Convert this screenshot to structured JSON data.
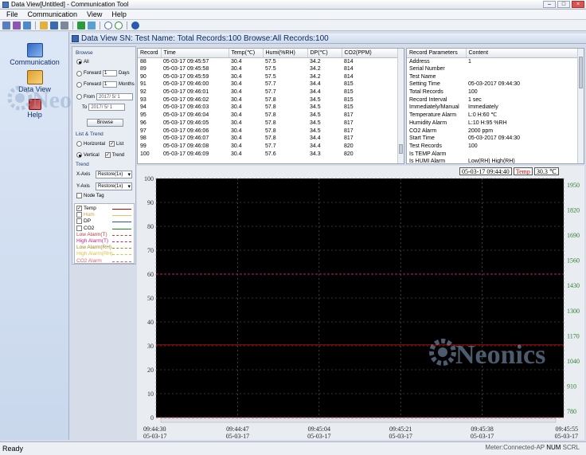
{
  "window": {
    "title": "Data View[Untitled] - Communication Tool"
  },
  "menu": [
    "File",
    "Communication",
    "View",
    "Help"
  ],
  "nav": {
    "communication": "Communication",
    "data_view": "Data View",
    "help": "Help"
  },
  "watermark": "Neonics",
  "header": {
    "text": "Data View  SN: Test Name:  Total Records:100 Browse:All Records:100"
  },
  "browse": {
    "group_label": "Browse",
    "all_label": "All",
    "forward_label": "Forward",
    "forward_days_value": "1",
    "days_label": "Days",
    "forward_months_value": "1",
    "months_label": "Months",
    "from_label": "From",
    "from_value": "2017/ 5/ 1",
    "to_label": "To",
    "to_value": "2017/ 5/ 1",
    "browse_button": "Browse"
  },
  "list_trend": {
    "group_label": "List & Trend",
    "horizontal_label": "Horizontal",
    "list_label": "List",
    "vertical_label": "Vertical",
    "trend_label": "Trend"
  },
  "trend": {
    "group_label": "Trend",
    "xaxis_label": "X-Axis",
    "xaxis_value": "Restore(1x)",
    "yaxis_label": "Y-Axis",
    "yaxis_value": "Restore(1x)",
    "nodetag_label": "Node Tag"
  },
  "legend": [
    {
      "label": "Temp",
      "checked": true,
      "checkbox": true,
      "color": "#c00000",
      "text_color": "#000000"
    },
    {
      "label": "Hum",
      "checked": false,
      "checkbox": true,
      "color": "#e0c060",
      "text_color": "#c0a040"
    },
    {
      "label": "DP",
      "checked": false,
      "checkbox": true,
      "color": "#3050c0",
      "text_color": "#000000"
    },
    {
      "label": "CO2",
      "checked": false,
      "checkbox": true,
      "color": "#208020",
      "text_color": "#000000"
    },
    {
      "label": "Low Alarm(T)",
      "checked": false,
      "checkbox": false,
      "color": "#c04040",
      "text_color": "#c04040"
    },
    {
      "label": "High Alarm(T)",
      "checked": false,
      "checkbox": false,
      "color": "#c02080",
      "text_color": "#c02080"
    },
    {
      "label": "Low Alarm(RH)",
      "checked": false,
      "checkbox": false,
      "color": "#a08020",
      "text_color": "#a08020"
    },
    {
      "label": "High Alarm(RH)",
      "checked": false,
      "checkbox": false,
      "color": "#e0c040",
      "text_color": "#e0c040"
    },
    {
      "label": "CO2 Alarm",
      "checked": false,
      "checkbox": false,
      "color": "#e06060",
      "text_color": "#e06060"
    }
  ],
  "records_table": {
    "columns": [
      "Record",
      "Time",
      "Temp(℃)",
      "Humi(%RH)",
      "DP(℃)",
      "CO2(PPM)"
    ],
    "rows": [
      [
        "88",
        "05-03-17 09:45:57",
        "30.4",
        "57.5",
        "34.2",
        "814"
      ],
      [
        "89",
        "05-03-17 09:45:58",
        "30.4",
        "57.5",
        "34.2",
        "814"
      ],
      [
        "90",
        "05-03-17 09:45:59",
        "30.4",
        "57.5",
        "34.2",
        "814"
      ],
      [
        "91",
        "05-03-17 09:46:00",
        "30.4",
        "57.7",
        "34.4",
        "815"
      ],
      [
        "92",
        "05-03-17 09:46:01",
        "30.4",
        "57.7",
        "34.4",
        "815"
      ],
      [
        "93",
        "05-03-17 09:46:02",
        "30.4",
        "57.8",
        "34.5",
        "815"
      ],
      [
        "94",
        "05-03-17 09:46:03",
        "30.4",
        "57.8",
        "34.5",
        "815"
      ],
      [
        "95",
        "05-03-17 09:46:04",
        "30.4",
        "57.8",
        "34.5",
        "817"
      ],
      [
        "96",
        "05-03-17 09:46:05",
        "30.4",
        "57.8",
        "34.5",
        "817"
      ],
      [
        "97",
        "05-03-17 09:46:06",
        "30.4",
        "57.8",
        "34.5",
        "817"
      ],
      [
        "98",
        "05-03-17 09:46:07",
        "30.4",
        "57.8",
        "34.4",
        "817"
      ],
      [
        "99",
        "05-03-17 09:46:08",
        "30.4",
        "57.7",
        "34.4",
        "820"
      ],
      [
        "100",
        "05-03-17 09:46:09",
        "30.4",
        "57.6",
        "34.3",
        "820"
      ]
    ]
  },
  "params_table": {
    "columns": [
      "Record Parameters",
      "Content"
    ],
    "rows": [
      [
        "Address",
        "1"
      ],
      [
        "Serial Number",
        ""
      ],
      [
        "Test Name",
        ""
      ],
      [
        "Setting Time",
        "05-03-2017 09:44:30"
      ],
      [
        "Total Records",
        "100"
      ],
      [
        "Record Interval",
        "1 sec"
      ],
      [
        "Immediately/Manual",
        "Immediately"
      ],
      [
        "Temperature Alarm",
        "L:0 H:60 ℃"
      ],
      [
        "Humidity Alarm",
        "L:10 H:95 %RH"
      ],
      [
        "CO2 Alarm",
        "2000 ppm"
      ],
      [
        "Start Time",
        "05-03-2017 09:44:30"
      ],
      [
        "Test Records",
        "100"
      ],
      [
        "Is TEMP Alarm",
        ""
      ],
      [
        "Is HUMI Alarm",
        "Low(RH) High(RH)"
      ]
    ]
  },
  "readout": {
    "time": "05-03-17 09:44:40",
    "label": "Temp",
    "value": "30.3 ℃"
  },
  "chart_data": {
    "type": "line",
    "series": [
      {
        "name": "Temp",
        "x": [
          0,
          99
        ],
        "values": [
          30.4,
          30.4
        ],
        "color": "#c00000"
      },
      {
        "name": "Low Alarm(T)",
        "x": [
          0,
          99
        ],
        "values": [
          0,
          0
        ],
        "color": "#c04040"
      },
      {
        "name": "High Alarm(T)",
        "x": [
          0,
          99
        ],
        "values": [
          60,
          60
        ],
        "color": "#c02080"
      }
    ],
    "ylim": [
      0,
      100
    ],
    "xlim": [
      0,
      85
    ],
    "y_ticks": [
      "0",
      "10",
      "20",
      "30",
      "40",
      "50",
      "60",
      "70",
      "80",
      "90",
      "100"
    ],
    "y2_ticks": [
      "780",
      "910",
      "1040",
      "1170",
      "1300",
      "1430",
      "1560",
      "1690",
      "1820",
      "1950"
    ],
    "x_ticks": [
      {
        "time": "09:44:30",
        "date": "05-03-17"
      },
      {
        "time": "09:44:47",
        "date": "05-03-17"
      },
      {
        "time": "09:45:04",
        "date": "05-03-17"
      },
      {
        "time": "09:45:21",
        "date": "05-03-17"
      },
      {
        "time": "09:45:38",
        "date": "05-03-17"
      },
      {
        "time": "09:45:55",
        "date": "05-03-17"
      }
    ],
    "grid": true,
    "background": "#000000"
  },
  "status": {
    "left": "Ready",
    "right_meter": "Meter:Connected-AP",
    "num": "NUM",
    "scrl": "SCRL"
  }
}
